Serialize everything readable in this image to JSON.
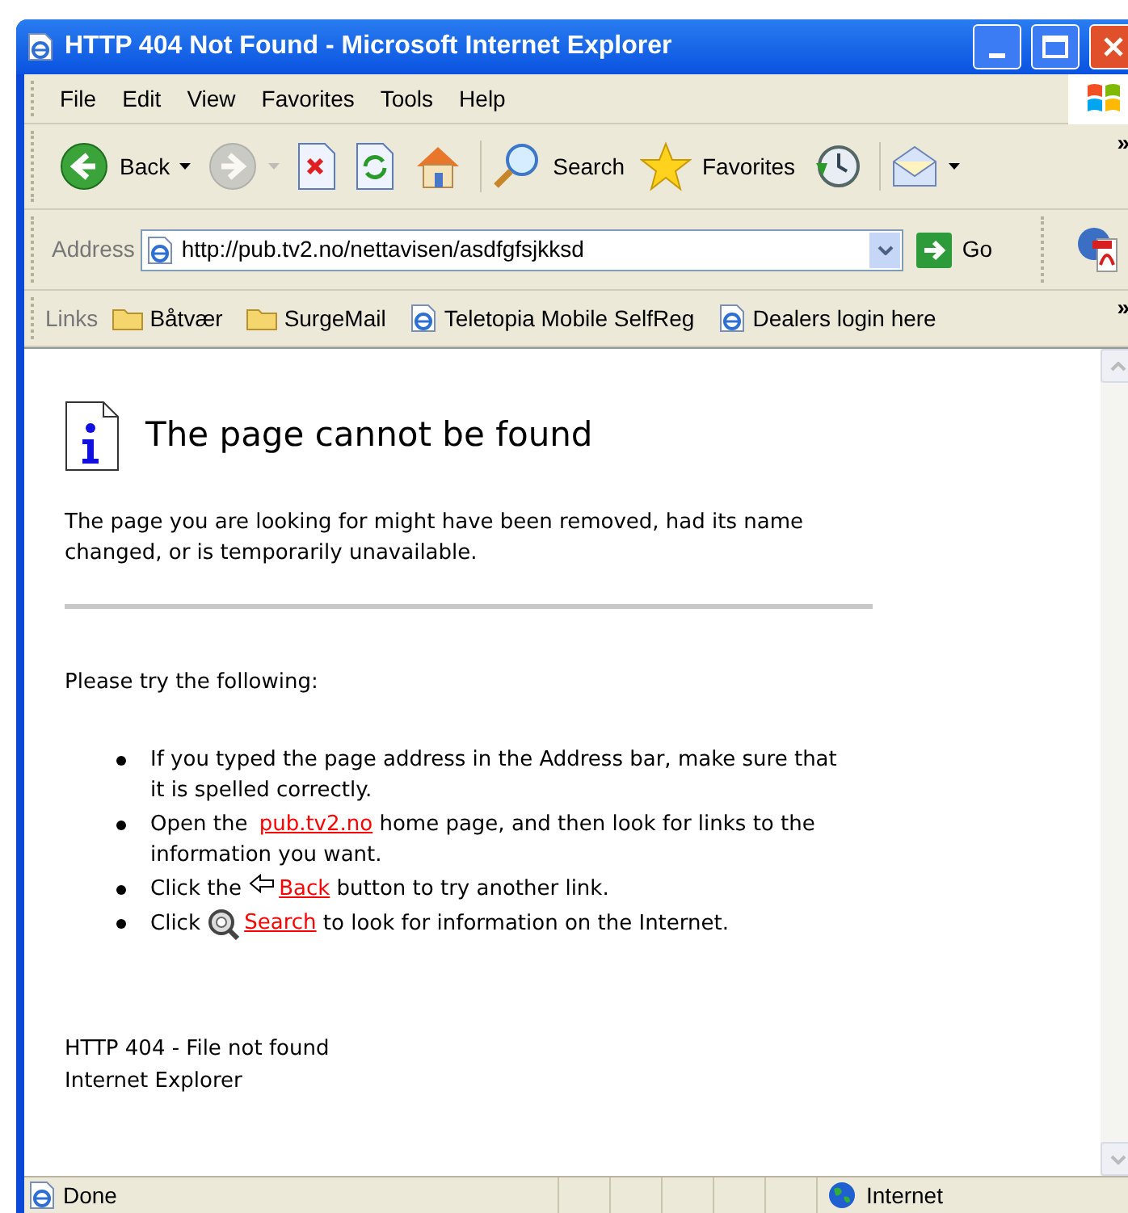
{
  "window": {
    "title": "HTTP 404 Not Found - Microsoft Internet Explorer"
  },
  "menu": [
    "File",
    "Edit",
    "View",
    "Favorites",
    "Tools",
    "Help"
  ],
  "toolbar": [
    {
      "kind": "back",
      "label": "Back",
      "disabled": false
    },
    {
      "kind": "forward",
      "disabled": true
    },
    {
      "kind": "stop",
      "disabled": false
    },
    {
      "kind": "refresh",
      "disabled": false
    },
    {
      "kind": "home",
      "disabled": false
    },
    {
      "kind": "search",
      "label": "Search",
      "disabled": false
    },
    {
      "kind": "favorites",
      "label": "Favorites",
      "disabled": false
    },
    {
      "kind": "history",
      "disabled": false
    },
    {
      "kind": "mail",
      "disabled": false
    }
  ],
  "address": {
    "label": "Address",
    "value": "http://pub.tv2.no/nettavisen/asdfgfsjkksd",
    "go": "Go"
  },
  "links_bar": {
    "label": "Links",
    "items": [
      {
        "kind": "folder",
        "label": "Båtvær"
      },
      {
        "kind": "folder",
        "label": "SurgeMail"
      },
      {
        "kind": "page",
        "label": "Teletopia Mobile SelfReg"
      },
      {
        "kind": "page",
        "label": "Dealers login here"
      }
    ],
    "more": "»"
  },
  "toolbar_more": "»",
  "page": {
    "heading": "The page cannot be found",
    "intro": "The page you are looking for might have been removed, had its name changed, or is temporarily unavailable.",
    "try_heading": "Please try the following:",
    "items": [
      [
        {
          "kind": "text",
          "text": "If you typed the page address in the Address bar, make sure that it is spelled correctly."
        }
      ],
      [
        {
          "kind": "text",
          "text": "Open the "
        },
        {
          "kind": "link",
          "text": "pub.tv2.no"
        },
        {
          "kind": "text",
          "text": " home page, and then look for links to the information you want."
        }
      ],
      [
        {
          "kind": "text",
          "text": "Click the "
        },
        {
          "kind": "arrow"
        },
        {
          "kind": "link",
          "text": "Back"
        },
        {
          "kind": "text",
          "text": " button to try another link."
        }
      ],
      [
        {
          "kind": "text",
          "text": "Click "
        },
        {
          "kind": "magnifier"
        },
        {
          "kind": "link",
          "text": "Search"
        },
        {
          "kind": "text",
          "text": " to look for information on the Internet."
        }
      ]
    ],
    "footer": [
      "HTTP 404 - File not found",
      "Internet Explorer"
    ]
  },
  "status_bar": {
    "text": "Done",
    "zone": "Internet"
  }
}
